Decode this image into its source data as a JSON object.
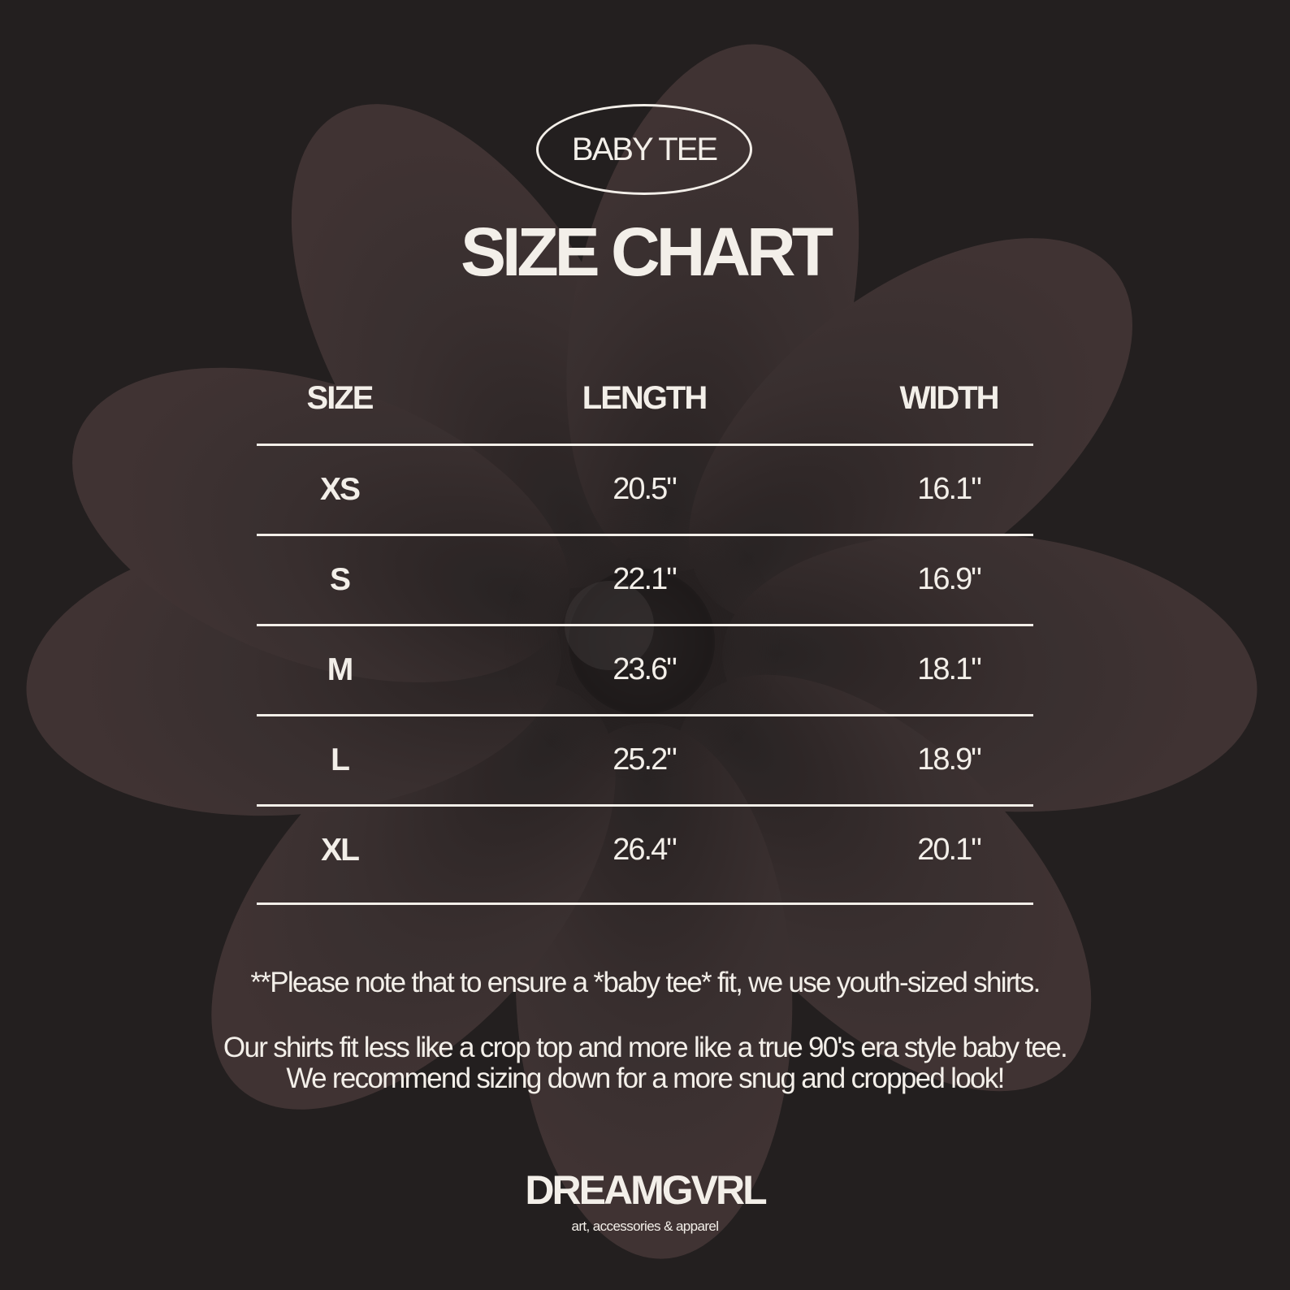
{
  "badge": {
    "label": "BABY TEE"
  },
  "title": "SIZE CHART",
  "table": {
    "headers": [
      "SIZE",
      "LENGTH",
      "WIDTH"
    ],
    "rows": [
      {
        "size": "XS",
        "length": "20.5\"",
        "width": "16.1\""
      },
      {
        "size": "S",
        "length": "22.1\"",
        "width": "16.9\""
      },
      {
        "size": "M",
        "length": "23.6\"",
        "width": "18.1\""
      },
      {
        "size": "L",
        "length": "25.2\"",
        "width": "18.9\""
      },
      {
        "size": "XL",
        "length": "26.4\"",
        "width": "20.1\""
      }
    ]
  },
  "notes": {
    "line1": "**Please note that to ensure a *baby tee* fit, we use youth-sized shirts.",
    "line2": "Our shirts fit less like a crop top and more like a true 90's era style baby tee.",
    "line3": "We recommend sizing down for a more snug and cropped look!"
  },
  "brand": {
    "name": "DREAMGVRL",
    "tagline": "art, accessories & apparel"
  },
  "colors": {
    "background": "#231f1f",
    "text": "#f3efe9",
    "petal": "#3a3030"
  },
  "icons": {
    "background": "flower-illustration"
  }
}
